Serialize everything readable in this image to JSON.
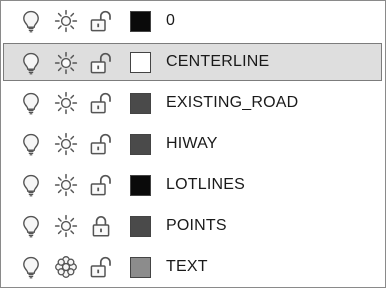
{
  "layers": [
    {
      "name": "0",
      "color": "#0a0a0a",
      "on": true,
      "frozen": false,
      "locked": false,
      "selected": false
    },
    {
      "name": "CENTERLINE",
      "color": "#ffffff",
      "on": true,
      "frozen": false,
      "locked": false,
      "selected": true
    },
    {
      "name": "EXISTING_ROAD",
      "color": "#4a4a4a",
      "on": true,
      "frozen": false,
      "locked": false,
      "selected": false
    },
    {
      "name": "HIWAY",
      "color": "#4a4a4a",
      "on": true,
      "frozen": false,
      "locked": false,
      "selected": false
    },
    {
      "name": "LOTLINES",
      "color": "#0a0a0a",
      "on": true,
      "frozen": false,
      "locked": false,
      "selected": false
    },
    {
      "name": "POINTS",
      "color": "#4a4a4a",
      "on": true,
      "frozen": false,
      "locked": true,
      "selected": false
    },
    {
      "name": "TEXT",
      "color": "#8c8c8c",
      "on": true,
      "frozen": true,
      "locked": false,
      "selected": false
    }
  ],
  "icons": {
    "on": "lightbulb-icon",
    "thawed": "sun-icon",
    "frozen": "snowflake-icon",
    "unlocked": "open-padlock-icon",
    "locked": "closed-padlock-icon"
  }
}
